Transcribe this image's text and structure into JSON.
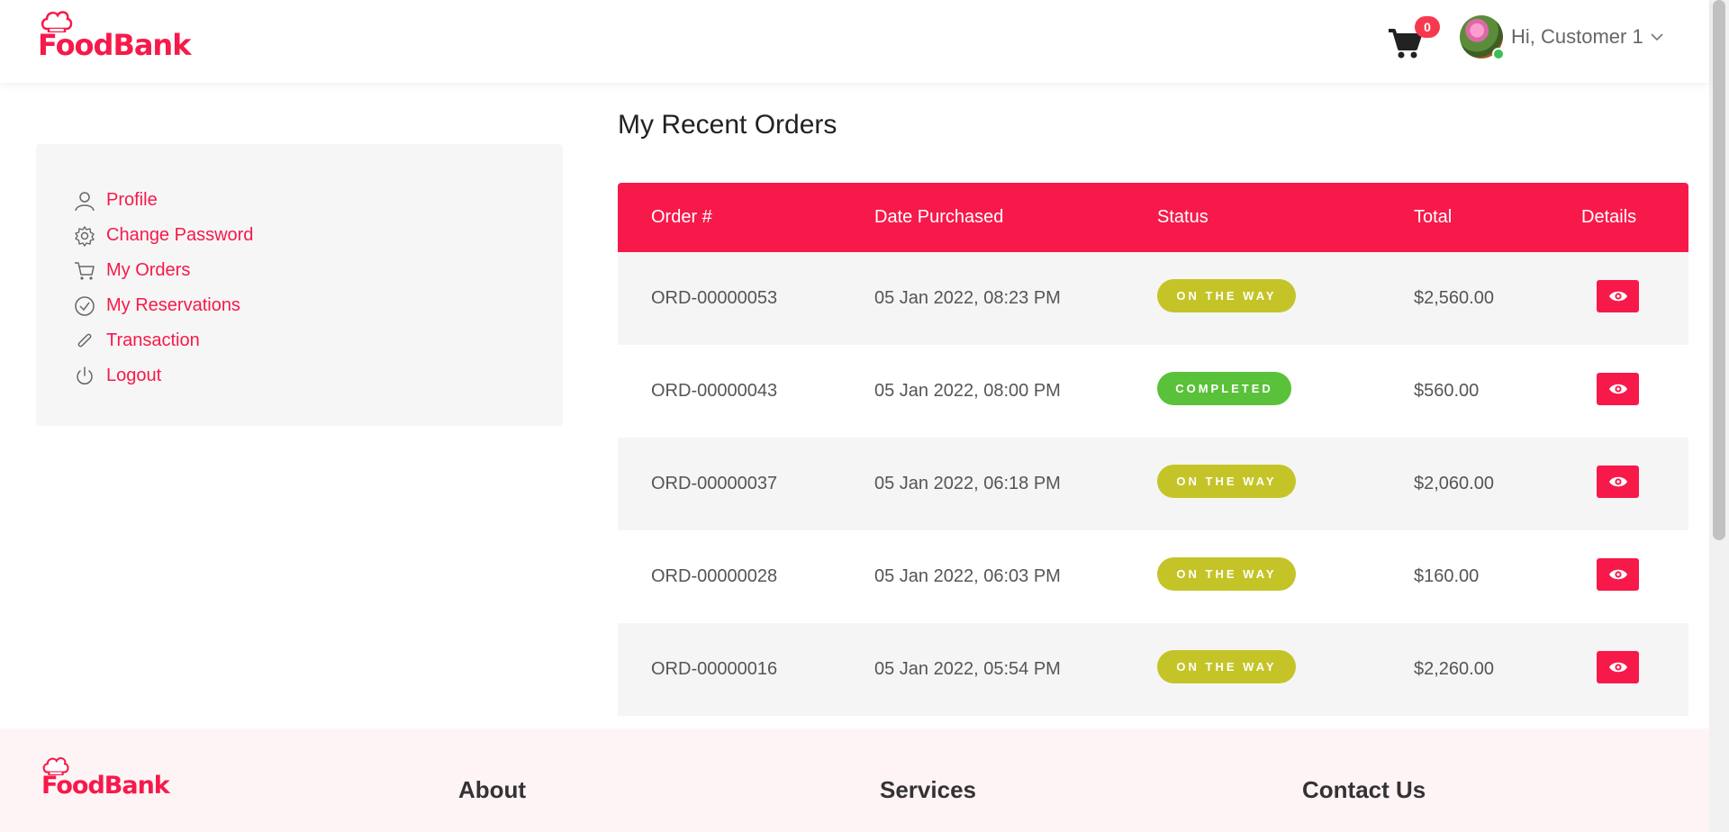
{
  "header": {
    "logo_text": "FoodBank",
    "cart_count": "0",
    "user_greeting": "Hi, Customer 1"
  },
  "sidebar": {
    "items": [
      {
        "label": "Profile",
        "icon": "user-icon"
      },
      {
        "label": "Change Password",
        "icon": "gear-icon"
      },
      {
        "label": "My Orders",
        "icon": "cart-icon"
      },
      {
        "label": "My Reservations",
        "icon": "check-circle-icon"
      },
      {
        "label": "Transaction",
        "icon": "paperclip-icon"
      },
      {
        "label": "Logout",
        "icon": "power-icon"
      }
    ]
  },
  "main": {
    "title": "My Recent Orders",
    "table": {
      "headers": [
        "Order #",
        "Date Purchased",
        "Status",
        "Total",
        "Details"
      ],
      "rows": [
        {
          "order": "ORD-00000053",
          "date": "05 Jan 2022, 08:23 PM",
          "status": "ON THE WAY",
          "total": "$2,560.00"
        },
        {
          "order": "ORD-00000043",
          "date": "05 Jan 2022, 08:00 PM",
          "status": "COMPLETED",
          "total": "$560.00"
        },
        {
          "order": "ORD-00000037",
          "date": "05 Jan 2022, 06:18 PM",
          "status": "ON THE WAY",
          "total": "$2,060.00"
        },
        {
          "order": "ORD-00000028",
          "date": "05 Jan 2022, 06:03 PM",
          "status": "ON THE WAY",
          "total": "$160.00"
        },
        {
          "order": "ORD-00000016",
          "date": "05 Jan 2022, 05:54 PM",
          "status": "ON THE WAY",
          "total": "$2,260.00"
        }
      ]
    }
  },
  "footer": {
    "logo_text": "FoodBank",
    "headings": [
      "About",
      "Services",
      "Contact Us"
    ]
  },
  "colors": {
    "brand": "#f7194a",
    "status_on_the_way": "#c4c428",
    "status_completed": "#5ac13a"
  }
}
